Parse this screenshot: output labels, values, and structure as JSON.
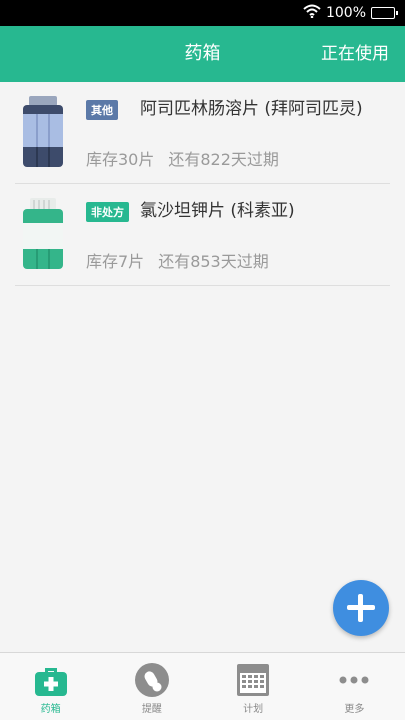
{
  "status_bar": {
    "battery": "100%"
  },
  "header": {
    "title": "药箱",
    "action": "正在使用"
  },
  "medicines": [
    {
      "tag": "其他",
      "tag_color": "#5b79a8",
      "name": "阿司匹林肠溶片 (拜阿司匹灵)",
      "stock": "库存30片",
      "expiry": "还有822天过期",
      "bottle_color": "#3d4b6b",
      "label_color": "#a9bde3"
    },
    {
      "tag": "非处方",
      "tag_color": "#27b890",
      "name": "氯沙坦钾片 (科素亚)",
      "stock": "库存7片",
      "expiry": "还有853天过期",
      "bottle_color": "#34b58a",
      "label_color": "#f2f6f4"
    }
  ],
  "tabs": [
    {
      "label": "药箱",
      "icon": "medicine-box-icon"
    },
    {
      "label": "提醒",
      "icon": "pill-reminder-icon"
    },
    {
      "label": "计划",
      "icon": "calendar-icon"
    },
    {
      "label": "更多",
      "icon": "more-dots-icon"
    }
  ],
  "colors": {
    "accent": "#27b890",
    "fab": "#3f8ee0"
  }
}
